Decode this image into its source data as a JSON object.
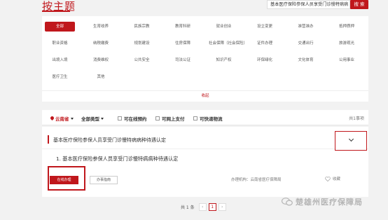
{
  "header": {
    "title": "按主题",
    "search_value": "基本医疗保险参保人员享受门诊慢特病病",
    "search_button": "搜 索"
  },
  "categories": [
    {
      "label": "全部",
      "active": true
    },
    {
      "label": "生育收养",
      "active": false
    },
    {
      "label": "民族宗教",
      "active": false
    },
    {
      "label": "教育科研",
      "active": false
    },
    {
      "label": "就业创业",
      "active": false
    },
    {
      "label": "设立变更",
      "active": false
    },
    {
      "label": "准营准办",
      "active": false
    },
    {
      "label": "抵押质押",
      "active": false
    },
    {
      "label": "职业资格",
      "active": false
    },
    {
      "label": "纳税缴费",
      "active": false
    },
    {
      "label": "规划建设",
      "active": false
    },
    {
      "label": "住房保障",
      "active": false
    },
    {
      "label": "社会保障（社会保险）",
      "active": false
    },
    {
      "label": "证件办理",
      "active": false
    },
    {
      "label": "交通出行",
      "active": false
    },
    {
      "label": "旅游观光",
      "active": false
    },
    {
      "label": "出境入境",
      "active": false
    },
    {
      "label": "消费维权",
      "active": false
    },
    {
      "label": "公共安全",
      "active": false
    },
    {
      "label": "司法公证",
      "active": false
    },
    {
      "label": "知识产权",
      "active": false
    },
    {
      "label": "环保绿化",
      "active": false
    },
    {
      "label": "文化体育",
      "active": false
    },
    {
      "label": "公用事业",
      "active": false
    },
    {
      "label": "医疗卫生",
      "active": false
    },
    {
      "label": "其他",
      "active": false
    }
  ],
  "collapse_label": "收起",
  "filters": {
    "region": "云南省",
    "type": "全部类型",
    "online_booking": "可在线预约",
    "online_pay": "可网上支付",
    "express": "可快递物流",
    "count": "共1事项"
  },
  "result": {
    "title": "基本医疗保险参保人员享受门诊慢特病病种待遇认定",
    "sub_title": "1. 基本医疗保险参保人员享受门诊慢特病病种待遇认定",
    "online_button": "在线办理",
    "guide_button": "办事指南",
    "org_label": "办理机构：",
    "org_value": "云南省医疗保障局",
    "fav_label": "收藏"
  },
  "pagination": {
    "total": "共 1 条",
    "prev": "‹",
    "current": "1",
    "next": "›"
  },
  "watermark": "楚雄州医疗保障局",
  "colors": {
    "accent": "#c0171c",
    "page_bg": "#f2f2f2"
  }
}
